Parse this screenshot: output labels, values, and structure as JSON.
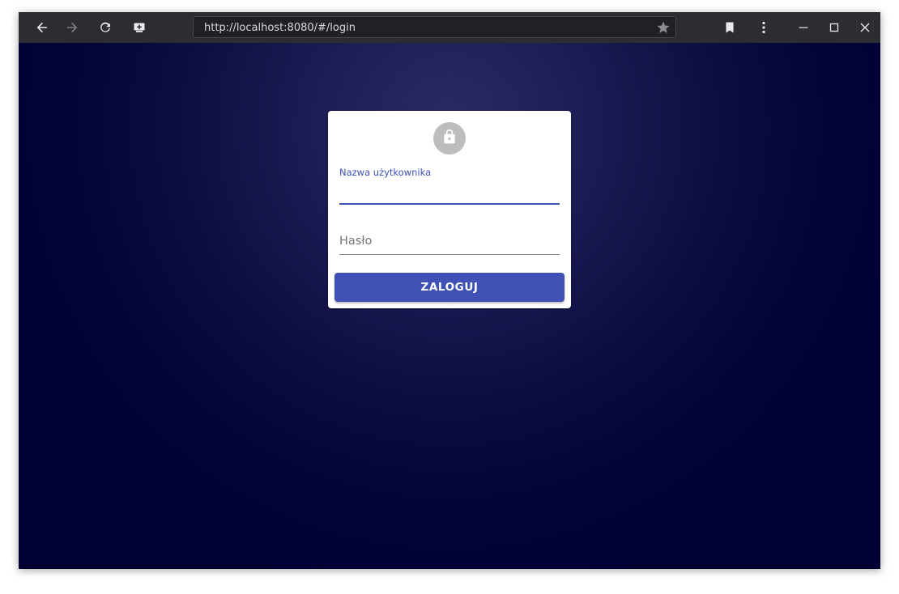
{
  "browser": {
    "url": "http://localhost:8080/#/login",
    "icons": {
      "back": "back-arrow-icon",
      "forward": "forward-arrow-icon",
      "reload": "reload-icon",
      "cast": "cast-icon",
      "star": "star-icon",
      "bookmarks": "bookmark-icon",
      "menu": "kebab-menu-icon",
      "minimize": "minimize-icon",
      "maximize": "maximize-icon",
      "close": "close-icon"
    }
  },
  "login": {
    "icon": "lock-icon",
    "username_label": "Nazwa użytkownika",
    "username_value": "",
    "password_label": "Hasło",
    "password_value": "",
    "submit_label": "ZALOGUJ"
  },
  "colors": {
    "primary": "#3f51b5",
    "background": "#000033",
    "avatar": "#bdbdbd",
    "titlebar": "#2b2d31"
  }
}
